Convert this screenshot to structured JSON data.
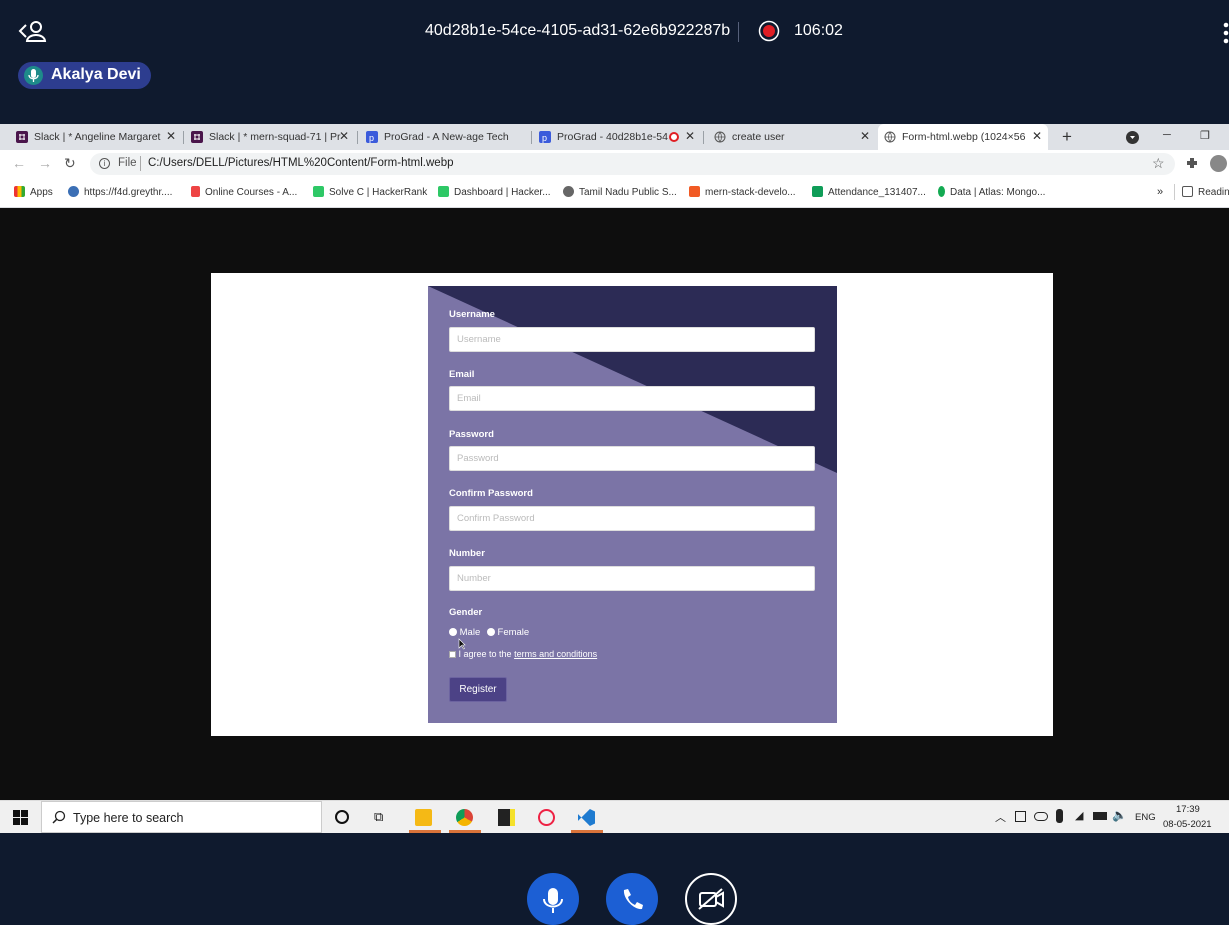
{
  "meeting": {
    "session_id": "40d28b1e-54ce-4105-ad31-62e6b922287b",
    "timer": "106:02",
    "speaker_name": "Akalya Devi"
  },
  "browser": {
    "tabs": [
      {
        "title": "Slack | * Angeline Margaret",
        "icon": "slack-icon"
      },
      {
        "title": "Slack | * mern-squad-71 | Pr",
        "icon": "slack-icon"
      },
      {
        "title": "ProGrad - A New-age Tech",
        "icon": "prograd-icon"
      },
      {
        "title": "ProGrad - 40d28b1e-54",
        "icon": "prograd-icon"
      },
      {
        "title": "create user",
        "icon": "globe-icon"
      },
      {
        "title": "Form-html.webp (1024×56",
        "icon": "globe-icon"
      }
    ],
    "address": {
      "scheme_label": "File",
      "url": "C:/Users/DELL/Pictures/HTML%20Content/Form-html.webp"
    },
    "bookmarks": [
      {
        "label": "Apps",
        "icon": "apps-icon"
      },
      {
        "label": "https://f4d.greythr....",
        "icon": "greythr-icon"
      },
      {
        "label": "Online Courses - A...",
        "icon": "udemy-icon"
      },
      {
        "label": "Solve C | HackerRank",
        "icon": "hackerrank-icon"
      },
      {
        "label": "Dashboard | Hacker...",
        "icon": "hackerrank-icon"
      },
      {
        "label": "Tamil Nadu Public S...",
        "icon": "globe-icon"
      },
      {
        "label": "mern-stack-develo...",
        "icon": "link-icon"
      },
      {
        "label": "Attendance_131407...",
        "icon": "sheets-icon"
      },
      {
        "label": "Data | Atlas: Mongo...",
        "icon": "mongodb-icon"
      }
    ],
    "more_bookmarks": "»",
    "reading_list": "Readin"
  },
  "form": {
    "fields": [
      {
        "label": "Username",
        "placeholder": "Username"
      },
      {
        "label": "Email",
        "placeholder": "Email"
      },
      {
        "label": "Password",
        "placeholder": "Password"
      },
      {
        "label": "Confirm Password",
        "placeholder": "Confirm Password"
      },
      {
        "label": "Number",
        "placeholder": "Number"
      }
    ],
    "gender_label": "Gender",
    "gender_options": [
      "Male",
      "Female"
    ],
    "agree_text": "I agree to the",
    "terms_link": "terms and conditions",
    "register_label": "Register"
  },
  "taskbar": {
    "search_placeholder": "Type here to search",
    "language": "ENG",
    "time": "17:39",
    "date": "08-05-2021"
  },
  "colors": {
    "meeting_bg": "#0f1a2e",
    "card_light": "#7b74a6",
    "card_dark": "#2c2b55",
    "register_btn": "#4c4286",
    "call_button": "#1c5fd4"
  }
}
